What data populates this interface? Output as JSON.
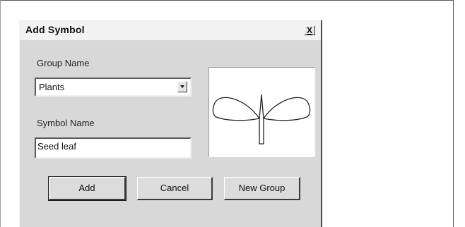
{
  "dialog": {
    "title": "Add Symbol",
    "close_label": "X"
  },
  "group": {
    "label": "Group Name",
    "selected": "Plants"
  },
  "symbol": {
    "label": "Symbol Name",
    "value": "Seed leaf"
  },
  "preview": {
    "icon": "seed-leaf-icon"
  },
  "buttons": {
    "add": "Add",
    "cancel": "Cancel",
    "new_group": "New Group"
  }
}
